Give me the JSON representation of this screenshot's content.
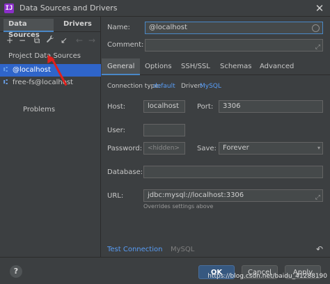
{
  "window": {
    "title": "Data Sources and Drivers",
    "app_icon_letter": "IJ"
  },
  "left": {
    "tabs": [
      {
        "label": "Data Sources"
      },
      {
        "label": "Drivers"
      }
    ],
    "toolbar": [
      {
        "icon": "add-icon",
        "glyph": "+"
      },
      {
        "icon": "remove-icon",
        "glyph": "−"
      },
      {
        "icon": "copy-icon",
        "glyph": "⧉"
      },
      {
        "icon": "wrench-icon",
        "glyph": "🔧"
      },
      {
        "icon": "import-icon",
        "glyph": "↙"
      },
      {
        "icon": "back-icon",
        "glyph": "←"
      },
      {
        "icon": "forward-icon",
        "glyph": "→"
      }
    ],
    "section_label": "Project Data Sources",
    "data_sources": [
      {
        "label": "@localhost"
      },
      {
        "label": "free-fs@localhost"
      }
    ],
    "problems_label": "Problems"
  },
  "form": {
    "name_label": "Name:",
    "name_value": "@localhost",
    "comment_label": "Comment:",
    "comment_value": "",
    "tabs": [
      {
        "label": "General"
      },
      {
        "label": "Options"
      },
      {
        "label": "SSH/SSL"
      },
      {
        "label": "Schemas"
      },
      {
        "label": "Advanced"
      }
    ],
    "connection_type_label": "Connection type:",
    "connection_type_value": "default",
    "driver_label": "Driver:",
    "driver_value": "MySQL",
    "host_label": "Host:",
    "host_value": "localhost",
    "port_label": "Port:",
    "port_value": "3306",
    "user_label": "User:",
    "user_value": "",
    "password_label": "Password:",
    "password_value": "<hidden>",
    "save_label": "Save:",
    "save_value": "Forever",
    "database_label": "Database:",
    "database_value": "",
    "url_label": "URL:",
    "url_value": "jdbc:mysql://localhost:3306",
    "url_hint": "Overrides settings above",
    "test_connection_label": "Test Connection",
    "driver_footer": "MySQL"
  },
  "bottom": {
    "help_label": "?",
    "ok_label": "OK",
    "cancel_label": "Cancel",
    "apply_label": "Apply",
    "watermark": "https://blog.csdn.net/baidu_41288190"
  }
}
